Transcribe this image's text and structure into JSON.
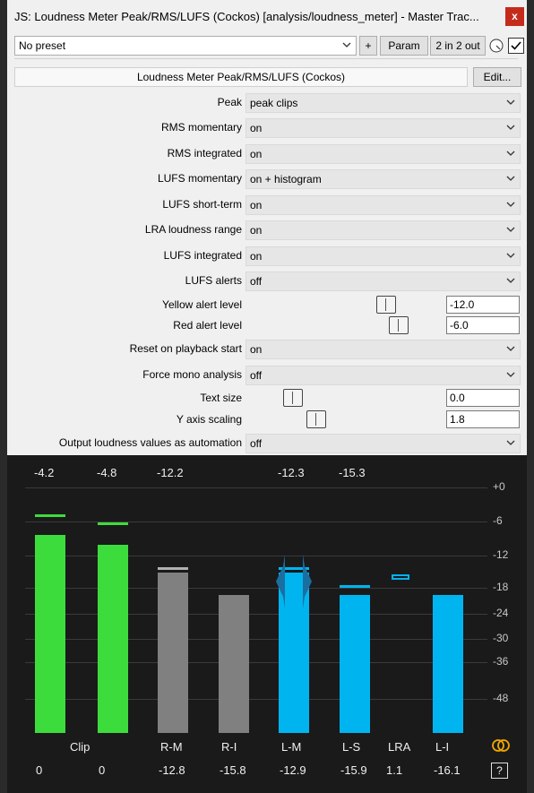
{
  "window": {
    "title": "JS: Loudness Meter Peak/RMS/LUFS (Cockos) [analysis/loudness_meter] - Master Trac...",
    "close_label": "x"
  },
  "toolbar": {
    "preset": "No preset",
    "add_label": "+",
    "param_label": "Param",
    "io_label": "2 in 2 out"
  },
  "plugin": {
    "name": "Loudness Meter Peak/RMS/LUFS (Cockos)",
    "edit_label": "Edit..."
  },
  "params": [
    {
      "label": "Peak",
      "type": "dropdown",
      "value": "peak clips"
    },
    {
      "label": "RMS momentary",
      "type": "dropdown",
      "value": "on"
    },
    {
      "label": "RMS integrated",
      "type": "dropdown",
      "value": "on"
    },
    {
      "label": "LUFS momentary",
      "type": "dropdown",
      "value": "on + histogram"
    },
    {
      "label": "LUFS short-term",
      "type": "dropdown",
      "value": "on"
    },
    {
      "label": "LRA loudness range",
      "type": "dropdown",
      "value": "on"
    },
    {
      "label": "LUFS integrated",
      "type": "dropdown",
      "value": "on"
    },
    {
      "label": "LUFS alerts",
      "type": "dropdown",
      "value": "off"
    },
    {
      "label": "Yellow alert level",
      "type": "slider",
      "value": "-12.0",
      "fraction": 0.77
    },
    {
      "label": "Red alert level",
      "type": "slider",
      "value": "-6.0",
      "fraction": 0.84
    },
    {
      "label": "Reset on playback start",
      "type": "dropdown",
      "value": "on"
    },
    {
      "label": "Force mono analysis",
      "type": "dropdown",
      "value": "off"
    },
    {
      "label": "Text size",
      "type": "slider",
      "value": "0.0",
      "fraction": 0.25
    },
    {
      "label": "Y axis scaling",
      "type": "slider",
      "value": "1.8",
      "fraction": 0.38
    },
    {
      "label": "Output loudness values as automation",
      "type": "dropdown",
      "value": "off"
    }
  ],
  "meter": {
    "scale": [
      "+0",
      "-6",
      "-12",
      "-18",
      "-24",
      "-30",
      "-36",
      "-48"
    ],
    "channels": [
      {
        "top": "-4.2",
        "label": "",
        "bottom": "0",
        "color": "#3ddc3d",
        "level": 0.79,
        "peak": 0.87
      },
      {
        "top": "-4.8",
        "label": "",
        "bottom": "0",
        "color": "#3ddc3d",
        "level": 0.75,
        "peak": 0.84
      },
      {
        "top": "-12.2",
        "label": "R-M",
        "bottom": "-12.8",
        "color": "#808080",
        "level": 0.64,
        "peak": 0.66
      },
      {
        "top": "",
        "label": "R-I",
        "bottom": "-15.8",
        "color": "#808080",
        "level": 0.55,
        "peak": 0
      },
      {
        "top": "-12.3",
        "label": "L-M",
        "bottom": "-12.9",
        "color": "#00b4f0",
        "level": 0.64,
        "peak": 0.66
      },
      {
        "top": "-15.3",
        "label": "L-S",
        "bottom": "-15.9",
        "color": "#00b4f0",
        "level": 0.55,
        "peak": 0.59
      },
      {
        "top": "",
        "label": "LRA",
        "bottom": "1.1",
        "color": "#00b4f0",
        "level": 0,
        "peak": 0
      },
      {
        "top": "",
        "label": "L-I",
        "bottom": "-16.1",
        "color": "#00b4f0",
        "level": 0.55,
        "peak": 0
      }
    ],
    "clip_label": "Clip",
    "help_label": "?"
  }
}
